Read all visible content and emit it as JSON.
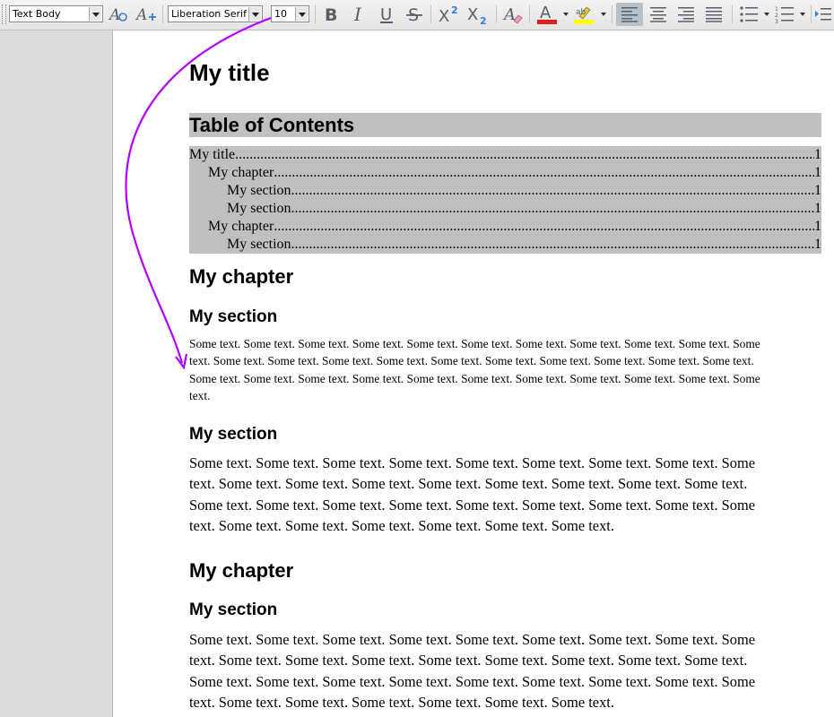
{
  "toolbar": {
    "paragraph_style": "Text Body",
    "font_name": "Liberation Serif",
    "font_size": "10",
    "icons": [
      "update-style-icon",
      "new-style-icon",
      "bold-icon",
      "italic-icon",
      "underline-icon",
      "strikethrough-icon",
      "superscript-icon",
      "subscript-icon",
      "clear-formatting-icon",
      "font-color-icon",
      "highlighting-icon",
      "align-left-icon",
      "align-center-icon",
      "align-right-icon",
      "justify-icon",
      "unordered-list-icon",
      "ordered-list-icon"
    ],
    "colors": {
      "font_color": "#e02020",
      "highlight_color": "#ffff00",
      "active_button": "#b8c0ca",
      "annotation_arrow": "#b300ff"
    }
  },
  "document": {
    "title": "My title",
    "toc": {
      "heading": "Table of Contents",
      "entries": [
        {
          "label": "My title",
          "page": "1",
          "level": 1
        },
        {
          "label": "My chapter",
          "page": "1",
          "level": 2
        },
        {
          "label": "My section",
          "page": "1",
          "level": 3
        },
        {
          "label": "My section",
          "page": "1",
          "level": 3
        },
        {
          "label": "My chapter",
          "page": "1",
          "level": 2
        },
        {
          "label": "My section",
          "page": "1",
          "level": 3
        }
      ]
    },
    "chapter1": {
      "heading": "My chapter",
      "section1": {
        "heading": "My section",
        "lines": [
          "Some text. Some text. Some text. Some text. Some text. Some text. Some text. Some text. Some text. Some text. Some",
          "text. Some text. Some text. Some text. Some text. Some text. Some text. Some text. Some text. Some text. Some text.",
          "Some text. Some text. Some text. Some text. Some text. Some text. Some text. Some text. Some text. Some text. Some",
          "text."
        ]
      },
      "section2": {
        "heading": "My section",
        "lines": [
          "Some text. Some text. Some text. Some text. Some text. Some text. Some text. Some text. Some",
          "text. Some text. Some text. Some text. Some text. Some text. Some text. Some text. Some text.",
          "Some text. Some text. Some text. Some text. Some text. Some text. Some text. Some text. Some",
          "text. Some text. Some text. Some text. Some text. Some text. Some text."
        ]
      }
    },
    "chapter2": {
      "heading": "My chapter",
      "section1": {
        "heading": "My section",
        "lines": [
          "Some text. Some text. Some text. Some text. Some text. Some text. Some text. Some text. Some",
          "text. Some text. Some text. Some text. Some text. Some text. Some text. Some text. Some text.",
          "Some text. Some text. Some text. Some text. Some text. Some text. Some text. Some text. Some",
          "text. Some text. Some text. Some text. Some text. Some text. Some text."
        ]
      }
    }
  }
}
